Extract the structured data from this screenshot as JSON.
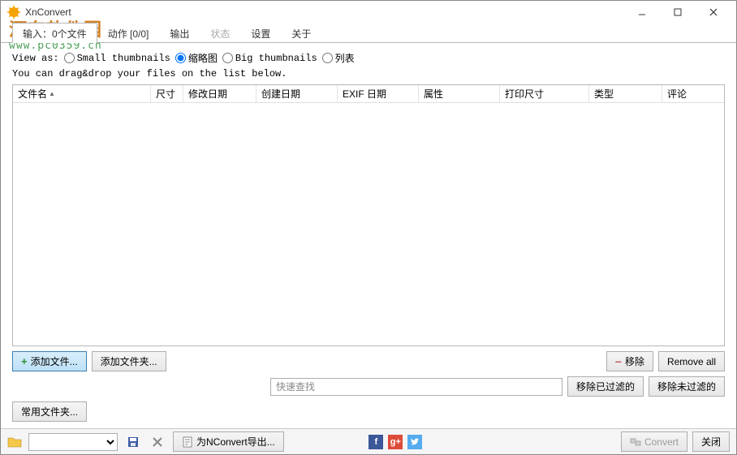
{
  "titlebar": {
    "app_name": "XnConvert"
  },
  "watermark": {
    "line1": "河东软件园",
    "line2": "www.pc0359.cn"
  },
  "tabs": {
    "input": "输入：0个文件",
    "actions": "动作 [0/0]",
    "output": "输出",
    "status": "状态",
    "settings": "设置",
    "about": "关于"
  },
  "viewas": {
    "label": "View as:",
    "small": "Small thumbnails",
    "thumb": "缩略图",
    "big": "Big thumbnails",
    "list": "列表"
  },
  "dragdrop": "You can drag&drop your files on the list below.",
  "columns": {
    "filename": "文件名",
    "size": "尺寸",
    "modified": "修改日期",
    "created": "创建日期",
    "exif": "EXIF 日期",
    "attrs": "属性",
    "printsize": "打印尺寸",
    "type": "类型",
    "comment": "评论"
  },
  "buttons": {
    "add_files": "添加文件...",
    "add_folder": "添加文件夹...",
    "remove": "移除",
    "remove_all": "Remove all",
    "remove_filtered": "移除已过滤的",
    "remove_unfiltered": "移除未过滤的",
    "common_folders": "常用文件夹...",
    "export_nconvert": "为NConvert导出...",
    "convert": "Convert",
    "close": "关闭"
  },
  "search": {
    "placeholder": "快速查找"
  }
}
